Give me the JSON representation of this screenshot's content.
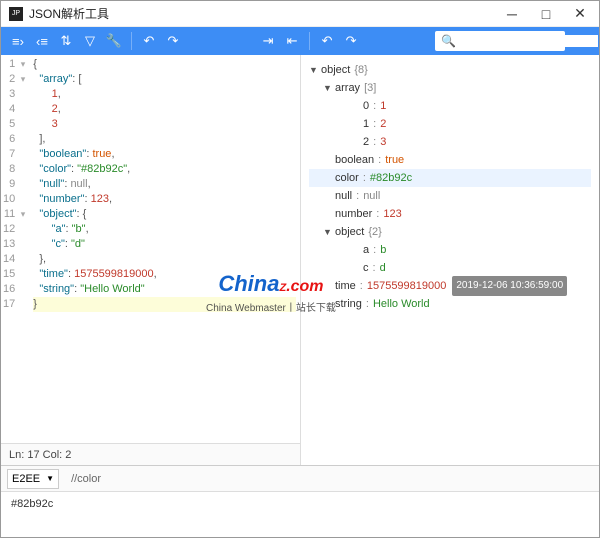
{
  "window": {
    "title": "JSON解析工具",
    "icon_label": "JP"
  },
  "toolbar": {
    "search_placeholder": ""
  },
  "editor": {
    "lines": [
      {
        "n": 1,
        "fold": true,
        "seg": [
          {
            "t": "{",
            "c": "brace"
          }
        ]
      },
      {
        "n": 2,
        "fold": true,
        "seg": [
          {
            "t": "  "
          },
          {
            "t": "\"array\"",
            "c": "k-key"
          },
          {
            "t": ": [",
            "c": "brace"
          }
        ]
      },
      {
        "n": 3,
        "seg": [
          {
            "t": "      "
          },
          {
            "t": "1",
            "c": "k-num"
          },
          {
            "t": ",",
            "c": "brace"
          }
        ]
      },
      {
        "n": 4,
        "seg": [
          {
            "t": "      "
          },
          {
            "t": "2",
            "c": "k-num"
          },
          {
            "t": ",",
            "c": "brace"
          }
        ]
      },
      {
        "n": 5,
        "seg": [
          {
            "t": "      "
          },
          {
            "t": "3",
            "c": "k-num"
          }
        ]
      },
      {
        "n": 6,
        "seg": [
          {
            "t": "  ],",
            "c": "brace"
          }
        ]
      },
      {
        "n": 7,
        "seg": [
          {
            "t": "  "
          },
          {
            "t": "\"boolean\"",
            "c": "k-key"
          },
          {
            "t": ": ",
            "c": "brace"
          },
          {
            "t": "true",
            "c": "k-bool"
          },
          {
            "t": ",",
            "c": "brace"
          }
        ]
      },
      {
        "n": 8,
        "seg": [
          {
            "t": "  "
          },
          {
            "t": "\"color\"",
            "c": "k-key"
          },
          {
            "t": ": ",
            "c": "brace"
          },
          {
            "t": "\"#82b92c\"",
            "c": "k-str"
          },
          {
            "t": ",",
            "c": "brace"
          }
        ]
      },
      {
        "n": 9,
        "seg": [
          {
            "t": "  "
          },
          {
            "t": "\"null\"",
            "c": "k-key"
          },
          {
            "t": ": ",
            "c": "brace"
          },
          {
            "t": "null",
            "c": "k-null"
          },
          {
            "t": ",",
            "c": "brace"
          }
        ]
      },
      {
        "n": 10,
        "seg": [
          {
            "t": "  "
          },
          {
            "t": "\"number\"",
            "c": "k-key"
          },
          {
            "t": ": ",
            "c": "brace"
          },
          {
            "t": "123",
            "c": "k-num"
          },
          {
            "t": ",",
            "c": "brace"
          }
        ]
      },
      {
        "n": 11,
        "fold": true,
        "seg": [
          {
            "t": "  "
          },
          {
            "t": "\"object\"",
            "c": "k-key"
          },
          {
            "t": ": {",
            "c": "brace"
          }
        ]
      },
      {
        "n": 12,
        "seg": [
          {
            "t": "      "
          },
          {
            "t": "\"a\"",
            "c": "k-key"
          },
          {
            "t": ": ",
            "c": "brace"
          },
          {
            "t": "\"b\"",
            "c": "k-str"
          },
          {
            "t": ",",
            "c": "brace"
          }
        ]
      },
      {
        "n": 13,
        "seg": [
          {
            "t": "      "
          },
          {
            "t": "\"c\"",
            "c": "k-key"
          },
          {
            "t": ": ",
            "c": "brace"
          },
          {
            "t": "\"d\"",
            "c": "k-str"
          }
        ]
      },
      {
        "n": 14,
        "seg": [
          {
            "t": "  },",
            "c": "brace"
          }
        ]
      },
      {
        "n": 15,
        "seg": [
          {
            "t": "  "
          },
          {
            "t": "\"time\"",
            "c": "k-key"
          },
          {
            "t": ": ",
            "c": "brace"
          },
          {
            "t": "1575599819000",
            "c": "k-num"
          },
          {
            "t": ",",
            "c": "brace"
          }
        ]
      },
      {
        "n": 16,
        "seg": [
          {
            "t": "  "
          },
          {
            "t": "\"string\"",
            "c": "k-key"
          },
          {
            "t": ": ",
            "c": "brace"
          },
          {
            "t": "\"Hello World\"",
            "c": "k-str"
          }
        ]
      },
      {
        "n": 17,
        "hl": true,
        "seg": [
          {
            "t": "}",
            "c": "brace"
          }
        ]
      }
    ],
    "status": "Ln: 17   Col: 2"
  },
  "tree": [
    {
      "indent": 0,
      "tri": "▼",
      "key": "object",
      "meta": "{8}"
    },
    {
      "indent": 1,
      "tri": "▼",
      "key": "array",
      "meta": "[3]"
    },
    {
      "indent": 3,
      "key": "0",
      "sep": ":",
      "val": "1",
      "vc": "tree-val-num"
    },
    {
      "indent": 3,
      "key": "1",
      "sep": ":",
      "val": "2",
      "vc": "tree-val-num"
    },
    {
      "indent": 3,
      "key": "2",
      "sep": ":",
      "val": "3",
      "vc": "tree-val-num"
    },
    {
      "indent": 1,
      "key": "boolean",
      "sep": ":",
      "val": "true",
      "vc": "tree-val-bool"
    },
    {
      "indent": 1,
      "key": "color",
      "sep": ":",
      "val": "#82b92c",
      "vc": "tree-val-str",
      "hl": true
    },
    {
      "indent": 1,
      "key": "null",
      "sep": ":",
      "val": "null",
      "vc": "tree-val-null"
    },
    {
      "indent": 1,
      "key": "number",
      "sep": ":",
      "val": "123",
      "vc": "tree-val-num"
    },
    {
      "indent": 1,
      "tri": "▼",
      "key": "object",
      "meta": "{2}"
    },
    {
      "indent": 3,
      "key": "a",
      "sep": ":",
      "val": "b",
      "vc": "tree-val-str"
    },
    {
      "indent": 3,
      "key": "c",
      "sep": ":",
      "val": "d",
      "vc": "tree-val-str"
    },
    {
      "indent": 1,
      "key": "time",
      "sep": ":",
      "val": "1575599819000",
      "vc": "tree-val-num",
      "badge": "2019-12-06 10:36:59:00"
    },
    {
      "indent": 1,
      "key": "string",
      "sep": ":",
      "val": "Hello World",
      "vc": "tree-val-str"
    }
  ],
  "query": {
    "lang": "E2EE",
    "expr": "//color",
    "result": "#82b92c"
  },
  "watermark": {
    "sub": "China Webmaster丨站长下载"
  }
}
